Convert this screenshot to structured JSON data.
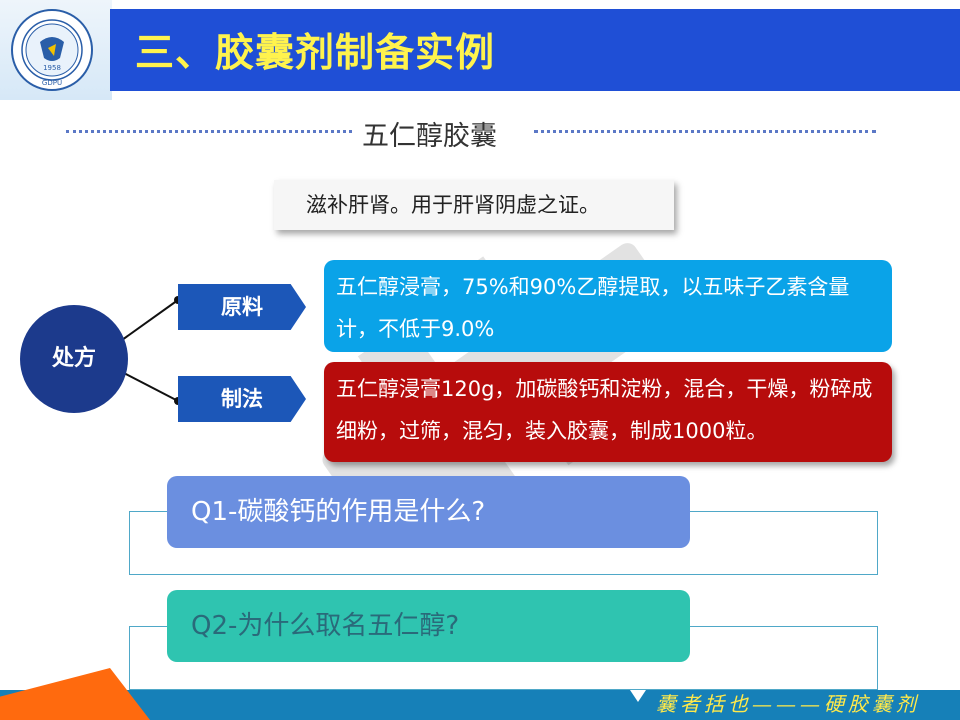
{
  "slide": {
    "title": "三、胶囊剂制备实例",
    "subtitle": "五仁醇胶囊",
    "summary": "滋补肝肾。用于肝肾阴虚之证。"
  },
  "logo": {
    "year": "1958",
    "abbrev": "GDPU",
    "icon": "university-seal-icon"
  },
  "prescription": {
    "center_label": "处方",
    "branches": [
      {
        "tag": "原料",
        "text": "五仁醇浸膏，75%和90%乙醇提取，以五味子乙素含量计，不低于9.0%"
      },
      {
        "tag": "制法",
        "text": "五仁醇浸膏120g，加碳酸钙和淀粉，混合，干燥，粉碎成细粉，过筛，混匀，装入胶囊，制成1000粒。"
      }
    ]
  },
  "questions": [
    {
      "label": "Q1-碳酸钙的作用是什么?"
    },
    {
      "label": "Q2-为什么取名五仁醇?"
    }
  ],
  "footer": {
    "slogan": "囊者括也———硬胶囊剂"
  },
  "colors": {
    "header_blue": "#1f4fd6",
    "title_yellow": "#fff34d",
    "card_blue": "#0aa3e8",
    "card_red": "#b70c0c",
    "circle_navy": "#1c3a8c",
    "q1_fill": "#6b8fe0",
    "q2_fill": "#2fc4b0",
    "footer_blue": "#1680b8",
    "footer_orange": "#ff6a0e"
  }
}
